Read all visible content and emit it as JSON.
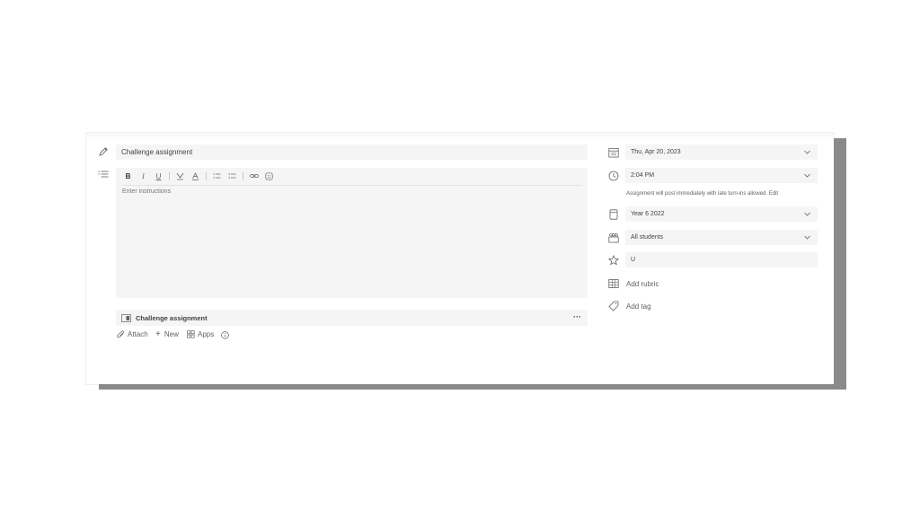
{
  "title": {
    "value": "Challenge assignment"
  },
  "instructions": {
    "placeholder": "Enter instructions"
  },
  "toolbar": {
    "bold": "B",
    "italic": "I",
    "underline": "U"
  },
  "attachment": {
    "label": "Challenge assignment",
    "more": "···"
  },
  "actions": {
    "attach": "Attach",
    "new": "New",
    "apps": "Apps"
  },
  "settings": {
    "due_date": "Thu, Apr 20, 2023",
    "due_time": "2:04 PM",
    "posting_note": "Assignment will post immediately with late turn-ins allowed. Edit",
    "class": "Year 6 2022",
    "students": "All students",
    "points": "U",
    "rubric": "Add rubric",
    "tag": "Add tag"
  },
  "colors": {
    "field_bg": "#f5f5f5",
    "icon": "#616161",
    "shadow": "#8a8a8a"
  }
}
